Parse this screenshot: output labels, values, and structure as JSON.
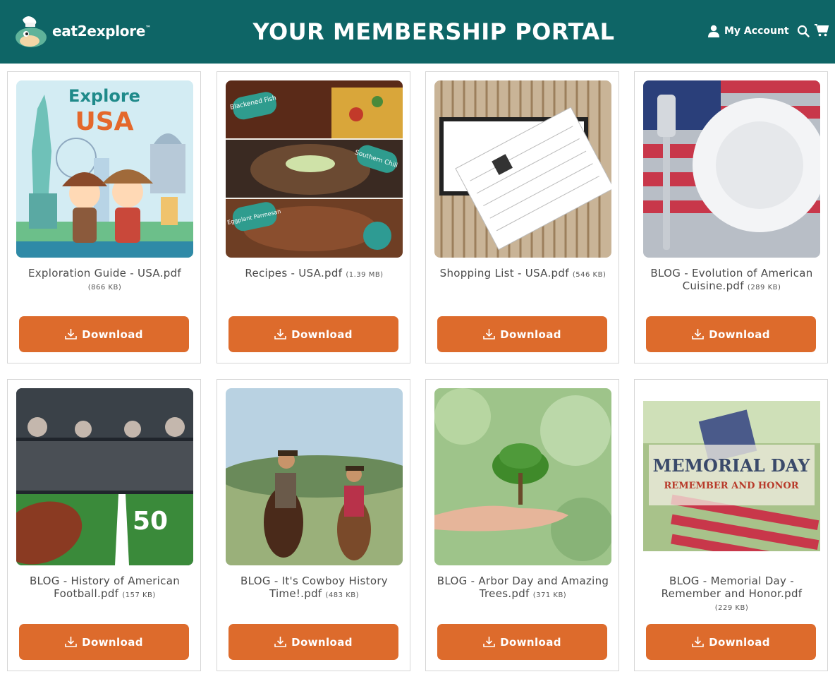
{
  "header": {
    "brand": "eat2explore",
    "trademark": "™",
    "title": "YOUR MEMBERSHIP PORTAL",
    "account_label": "My Account",
    "icons": [
      "user-icon",
      "search-icon",
      "cart-icon"
    ]
  },
  "colors": {
    "header_bg": "#0e6566",
    "button_bg": "#dd6b2c",
    "card_border": "#d6d6d6"
  },
  "cards": [
    {
      "title": "Exploration Guide - USA.pdf",
      "size": "(866 KB)",
      "button": "Download",
      "image": "Explore USA illustrated guide cover with Statue of Liberty and cowboy kids"
    },
    {
      "title": "Recipes - USA.pdf",
      "size": "(1.39 MB)",
      "button": "Download",
      "image": "Blackened Fish, Southern Chili, Eggplant Parmesan recipe photos"
    },
    {
      "title": "Shopping List - USA.pdf",
      "size": "(546 KB)",
      "button": "Download",
      "image": "Shopping list card on striped placemat"
    },
    {
      "title": "BLOG - Evolution of American Cuisine.pdf",
      "size": "(289 KB)",
      "button": "Download",
      "image": "Fork and plate on American flag table"
    },
    {
      "title": "BLOG - History of American Football.pdf",
      "size": "(157 KB)",
      "button": "Download",
      "image": "Football on stadium field at 50 yard line"
    },
    {
      "title": "BLOG - It's Cowboy History Time!.pdf",
      "size": "(483 KB)",
      "button": "Download",
      "image": "Two cowboys riding horses"
    },
    {
      "title": "BLOG - Arbor Day and Amazing Trees.pdf",
      "size": "(371 KB)",
      "button": "Download",
      "image": "Hand holding small tree"
    },
    {
      "title": "BLOG - Memorial Day - Remember and Honor.pdf",
      "size": "(229 KB)",
      "button": "Download",
      "image": "Memorial Day flag banner"
    }
  ],
  "thumb_text": {
    "explore_1": "Explore",
    "explore_2": "USA",
    "recipe_1": "Blackened Fish",
    "recipe_2": "Southern Chili",
    "recipe_3": "Eggplant Parmesan",
    "memorial_1": "MEMORIAL DAY",
    "memorial_2": "REMEMBER AND HONOR",
    "field_50": "50"
  }
}
